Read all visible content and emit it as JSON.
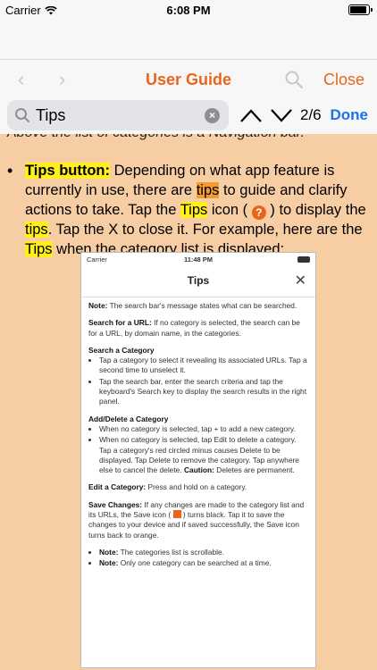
{
  "status_bar": {
    "carrier": "Carrier",
    "time": "6:08 PM"
  },
  "nav": {
    "back_glyph": "‹",
    "forward_glyph": "›",
    "title": "User Guide",
    "close_label": "Close"
  },
  "find": {
    "query": "Tips",
    "match_count": "2/6",
    "done_label": "Done",
    "clear_glyph": "×"
  },
  "content": {
    "cut_line": "Above the list of categories is a Navigation bar.",
    "bullet": {
      "term": "Tips button:",
      "text_1": " Depending on what app feature is currently in use, there are ",
      "hl_1": "tips",
      "text_2": " to guide and clarify actions to take. Tap the ",
      "hl_2": "Tips",
      "text_3": " icon ( ",
      "icon_glyph": "?",
      "text_4": " ) to display the ",
      "hl_3": "tips",
      "text_5": ". Tap the X to close it. For example, here are the ",
      "hl_4": "Tips",
      "text_6": " when the category list is displayed:"
    }
  },
  "embedded": {
    "carrier": "Carrier",
    "time": "11:48 PM",
    "title": "Tips",
    "close_glyph": "✕",
    "note_label": "Note:",
    "note_text": " The search bar's message states what can be searched.",
    "url_label": "Search for a URL:",
    "url_text": " If no category is selected, the search can be for a URL, by domain name, in the categories.",
    "cat_heading": "Search a Category",
    "cat_items": [
      "Tap a category to select it revealing its associated URLs. Tap a second time to unselect it.",
      "Tap the search bar, enter the search criteria and tap the keyboard's Search key to display the search results in the right panel."
    ],
    "add_heading": "Add/Delete a Category",
    "add_item_1": "When no category is selected, tap + to add a new category.",
    "add_item_2_a": "When no category is selected, tap Edit to delete a category. Tap a category's red circled minus causes Delete to be displayed. Tap Delete to remove the category. Tap anywhere else to cancel the delete. ",
    "add_item_2_b": "Caution:",
    "add_item_2_c": " Deletes are permanent.",
    "edit_label": "Edit a Category:",
    "edit_text": " Press and hold on a category.",
    "save_label": "Save Changes:",
    "save_text_a": " If any changes are made to the category list and its URLs, the Save icon ( ",
    "save_text_b": " ) turns black. Tap it to save the changes to your device and if saved successfully, the Save icon turns back to orange.",
    "note_items": [
      {
        "label": "Note:",
        "text": " The categories list is scrollable."
      },
      {
        "label": "Note:",
        "text": " Only one category can be searched at a time."
      }
    ]
  },
  "colors": {
    "accent": "#e8661c",
    "highlight": "#ffef1a",
    "current_match": "#f49a33",
    "page_bg": "#f7cda4",
    "done": "#1a73e8"
  },
  "icons": [
    "wifi-icon",
    "battery-icon",
    "back-icon",
    "forward-icon",
    "search-icon",
    "magnifier-icon",
    "clear-icon",
    "chevron-up-icon",
    "chevron-down-icon",
    "help-icon",
    "close-icon",
    "save-icon"
  ]
}
